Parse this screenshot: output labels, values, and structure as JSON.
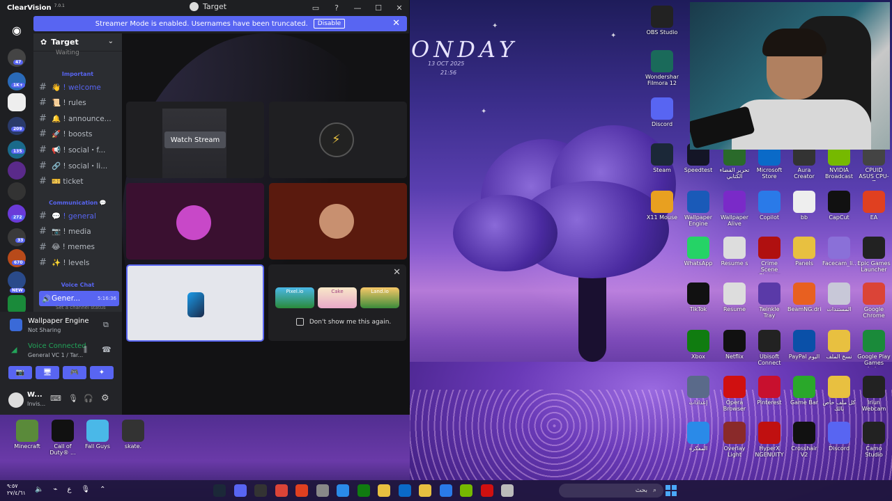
{
  "wallpaper": {
    "day": "ONDAY",
    "date": "13 OCT 2025",
    "time": "21:56"
  },
  "window": {
    "app_name": "ClearVision",
    "version": "7.0.1",
    "title": "Target",
    "banner_text": "Streamer Mode is enabled. Usernames have been truncated.",
    "banner_button": "Disable"
  },
  "guild_badges": [
    "47",
    "1K+",
    "209",
    "135",
    "272",
    "33",
    "670",
    "NEW"
  ],
  "server": {
    "name": "Target",
    "waiting": "Waiting",
    "categories": {
      "important": "Important",
      "communication": "Communication 💬",
      "voice": "Voice Chat"
    },
    "channels_important": [
      "👋 ! welcome",
      "📜 ! rules",
      "🔔 ! announce...",
      "🚀 ! boosts",
      "📢 ! social・f...",
      "🔗 ! social・li...",
      "🎫 ticket"
    ],
    "channels_comm": [
      "💬 ! general",
      "📷 ! media",
      "😂 ! memes",
      "✨ ! levels"
    ],
    "voice_channel": "Gener...",
    "voice_time": "5:16:36",
    "voice_status": "Set a channel status"
  },
  "panel": {
    "activity_title": "Wallpaper Engine",
    "activity_sub": "Not Sharing",
    "voice_title": "Voice Connected",
    "voice_sub": "General VC 1 / Tar...",
    "user_name": "W...",
    "user_status": "Invis..."
  },
  "stage": {
    "watch_label": "Watch Stream",
    "promo_text": "Don't show me this again.",
    "promo_games": [
      "Pixel.io",
      "Cake",
      "Land.io"
    ]
  },
  "desktop_icons": [
    {
      "label": "OBS Studio",
      "color": "#222"
    },
    {
      "label": "Wondershare Filmora 12",
      "color": "#1a6a5a"
    },
    {
      "label": "Discord",
      "color": "#5865f2"
    },
    {
      "label": "Steam",
      "color": "#1b2838"
    },
    {
      "label": "Speedtest",
      "color": "#141526"
    },
    {
      "label": "تحرير الفضاء الكتابي",
      "color": "#2a6a2a"
    },
    {
      "label": "Microsoft Store",
      "color": "#0a6ac8"
    },
    {
      "label": "Aura Creator",
      "color": "#333"
    },
    {
      "label": "NVIDIA Broadcast",
      "color": "#76b900"
    },
    {
      "label": "CPUID ASUS CPU-Z",
      "color": "#444"
    },
    {
      "label": "X11 Mouse",
      "color": "#e8a020"
    },
    {
      "label": "Wallpaper Engine",
      "color": "#1a5ab8"
    },
    {
      "label": "Wallpaper Alive",
      "color": "#7a2ac8"
    },
    {
      "label": "Copilot",
      "color": "#2a7ae8"
    },
    {
      "label": "bb",
      "color": "#eee"
    },
    {
      "label": "CapCut",
      "color": "#111"
    },
    {
      "label": "EA",
      "color": "#e04020"
    },
    {
      "label": "WhatsApp",
      "color": "#25d366"
    },
    {
      "label": "Resume s",
      "color": "#ddd"
    },
    {
      "label": "Crime Scene Cleaner",
      "color": "#b01010"
    },
    {
      "label": "Panels",
      "color": "#e8c040"
    },
    {
      "label": "Facecam_li...",
      "color": "#8a70d8"
    },
    {
      "label": "Epic Games Launcher",
      "color": "#222"
    },
    {
      "label": "TikTok",
      "color": "#111"
    },
    {
      "label": "Resume",
      "color": "#ddd"
    },
    {
      "label": "Twinkle Tray",
      "color": "#5a3aa8"
    },
    {
      "label": "BeamNG.dri...",
      "color": "#e86020"
    },
    {
      "label": "المستندات",
      "color": "#c8c8d8"
    },
    {
      "label": "Google Chrome",
      "color": "#db4437"
    },
    {
      "label": "Xbox",
      "color": "#107c10"
    },
    {
      "label": "Netflix",
      "color": "#111"
    },
    {
      "label": "Ubisoft Connect",
      "color": "#222"
    },
    {
      "label": "PayPal اليوم",
      "color": "#0a50a8"
    },
    {
      "label": "نسخ الملف",
      "color": "#e8c040"
    },
    {
      "label": "Google Play Games beta",
      "color": "#1a8a3a"
    },
    {
      "label": "إعدادات",
      "color": "#5a6a8a"
    },
    {
      "label": "Opera Browser",
      "color": "#d01010"
    },
    {
      "label": "Pinterest",
      "color": "#c8102e"
    },
    {
      "label": "Game Bar",
      "color": "#2aa82a"
    },
    {
      "label": "كل ملف خاص بالك",
      "color": "#e8c040"
    },
    {
      "label": "Iriun Webcam",
      "color": "#222"
    },
    {
      "label": "المفكرة",
      "color": "#2a8ae8"
    },
    {
      "label": "Overlay Light",
      "color": "#8a2a2a"
    },
    {
      "label": "HyperX NGENUITY",
      "color": "#c01010"
    },
    {
      "label": "Crosshair V2",
      "color": "#111"
    },
    {
      "label": "Discord",
      "color": "#5865f2"
    },
    {
      "label": "Camo Studio",
      "color": "#222"
    },
    {
      "label": "Minecraft",
      "color": "#5a8a3a"
    },
    {
      "label": "Call of Duty® ...",
      "color": "#111"
    },
    {
      "label": "Fall Guys",
      "color": "#4ab8e8"
    },
    {
      "label": "skate.",
      "color": "#333"
    }
  ],
  "taskbar": {
    "search_placeholder": "بحث",
    "clock_time": "٩:٥٧",
    "clock_date": "٢٧/٤/٦١",
    "lang": "ع"
  }
}
